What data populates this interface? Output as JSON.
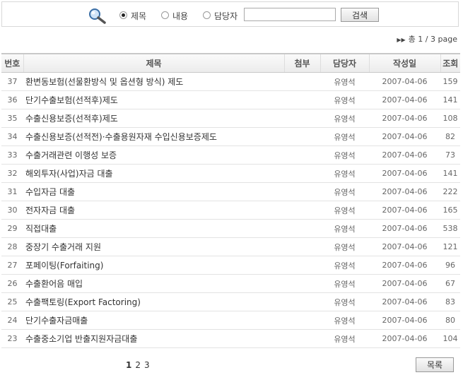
{
  "search": {
    "options": [
      "제목",
      "내용",
      "담당자"
    ],
    "selected": "제목",
    "input_value": "",
    "button_label": "검색"
  },
  "page_info": {
    "total_label": "총",
    "current": "1",
    "separator": "/",
    "total": "3",
    "unit": "page"
  },
  "table": {
    "headers": [
      "번호",
      "제목",
      "첨부",
      "담당자",
      "작성일",
      "조회"
    ],
    "rows": [
      {
        "no": "37",
        "title": "환변동보험(선물환방식 및 옵션형 방식) 제도",
        "attach": "",
        "author": "유영석",
        "date": "2007-04-06",
        "views": "159"
      },
      {
        "no": "36",
        "title": "단기수출보험(선적후)제도",
        "attach": "",
        "author": "유영석",
        "date": "2007-04-06",
        "views": "141"
      },
      {
        "no": "35",
        "title": "수출신용보증(선적후)제도",
        "attach": "",
        "author": "유영석",
        "date": "2007-04-06",
        "views": "108"
      },
      {
        "no": "34",
        "title": "수출신용보증(선적전)·수출용원자재 수입신용보증제도",
        "attach": "",
        "author": "유영석",
        "date": "2007-04-06",
        "views": "82"
      },
      {
        "no": "33",
        "title": "수출거래관련 이행성 보증",
        "attach": "",
        "author": "유영석",
        "date": "2007-04-06",
        "views": "73"
      },
      {
        "no": "32",
        "title": "해외투자(사업)자금 대출",
        "attach": "",
        "author": "유영석",
        "date": "2007-04-06",
        "views": "141"
      },
      {
        "no": "31",
        "title": "수입자금 대출",
        "attach": "",
        "author": "유영석",
        "date": "2007-04-06",
        "views": "222"
      },
      {
        "no": "30",
        "title": "전자자금 대출",
        "attach": "",
        "author": "유영석",
        "date": "2007-04-06",
        "views": "165"
      },
      {
        "no": "29",
        "title": "직접대출",
        "attach": "",
        "author": "유영석",
        "date": "2007-04-06",
        "views": "538"
      },
      {
        "no": "28",
        "title": "중장기 수출거래 지원",
        "attach": "",
        "author": "유영석",
        "date": "2007-04-06",
        "views": "121"
      },
      {
        "no": "27",
        "title": "포페이팅(Forfaiting)",
        "attach": "",
        "author": "유영석",
        "date": "2007-04-06",
        "views": "96"
      },
      {
        "no": "26",
        "title": "수출환어음 매입",
        "attach": "",
        "author": "유영석",
        "date": "2007-04-06",
        "views": "67"
      },
      {
        "no": "25",
        "title": "수출팩토링(Export Factoring)",
        "attach": "",
        "author": "유영석",
        "date": "2007-04-06",
        "views": "83"
      },
      {
        "no": "24",
        "title": "단기수출자금매출",
        "attach": "",
        "author": "유영석",
        "date": "2007-04-06",
        "views": "80"
      },
      {
        "no": "23",
        "title": "수출중소기업 반출지원자금대출",
        "attach": "",
        "author": "유영석",
        "date": "2007-04-06",
        "views": "104"
      }
    ]
  },
  "pagination": {
    "pages": [
      "1",
      "2",
      "3"
    ],
    "current": "1"
  },
  "list_button_label": "목록",
  "icons": {
    "search": "magnifier-icon",
    "page_arrow": "double-arrow-icon"
  }
}
